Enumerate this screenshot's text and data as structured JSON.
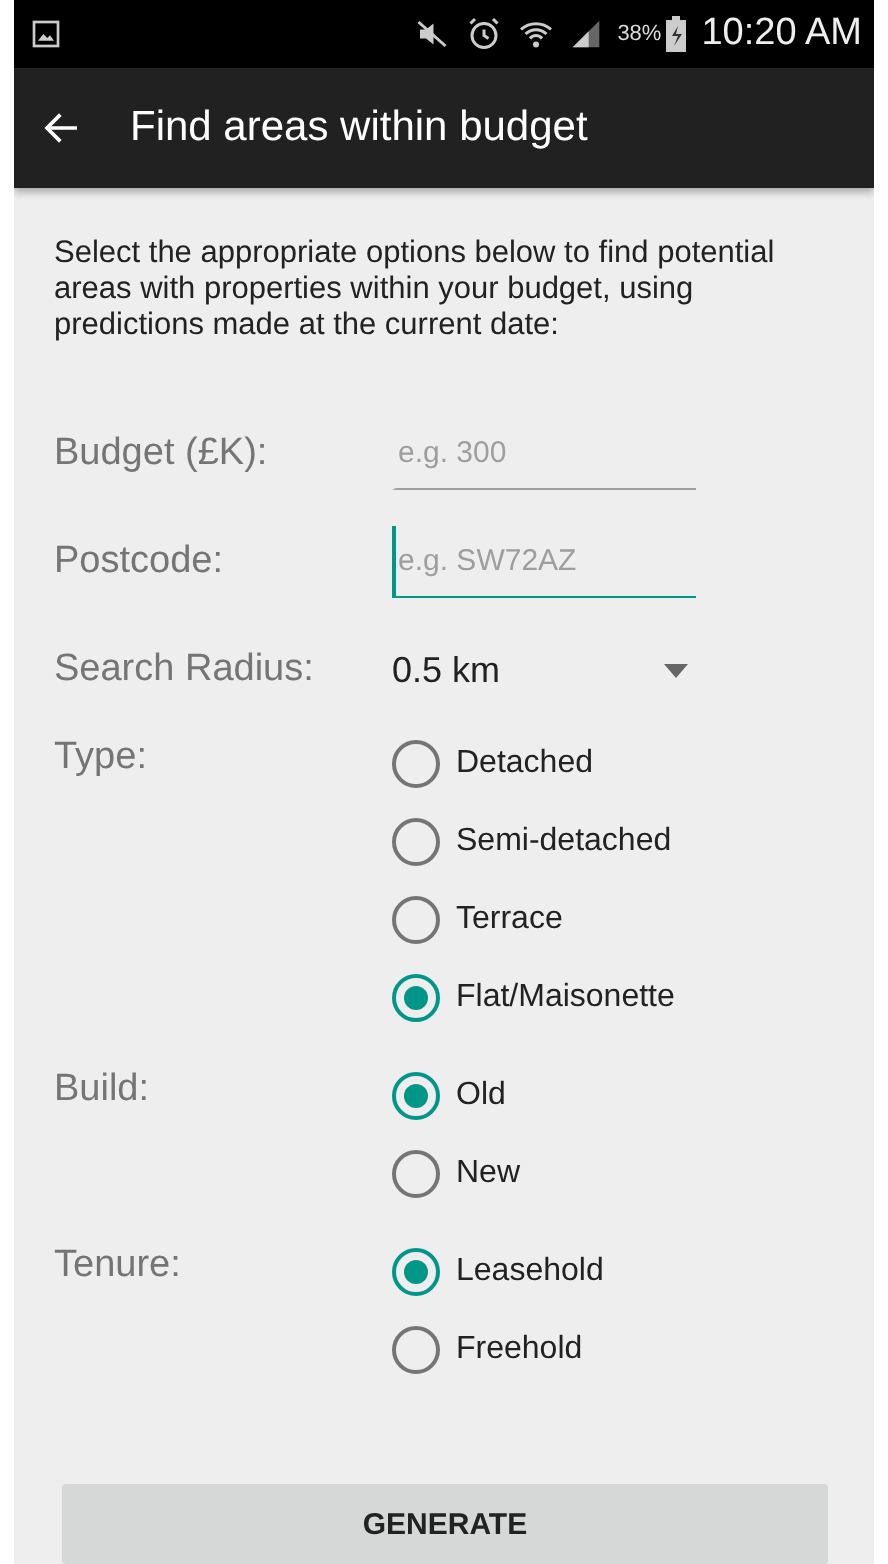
{
  "status_bar": {
    "battery": "38%",
    "time": "10:20 AM"
  },
  "app_bar": {
    "title": "Find areas within budget"
  },
  "intro": "Select the appropriate options below to find potential areas with properties within your budget, using predictions made at the current date:",
  "fields": [
    {
      "label": "Budget (£K):",
      "placeholder": "e.g. 300",
      "focused": false
    },
    {
      "label": "Postcode:",
      "placeholder": "e.g. SW72AZ",
      "focused": true
    }
  ],
  "search_radius": {
    "label": "Search Radius:",
    "value": "0.5 km"
  },
  "groups": [
    {
      "label": "Type:",
      "options": [
        {
          "label": "Detached",
          "selected": false
        },
        {
          "label": "Semi-detached",
          "selected": false
        },
        {
          "label": "Terrace",
          "selected": false
        },
        {
          "label": "Flat/Maisonette",
          "selected": true
        }
      ]
    },
    {
      "label": "Build:",
      "options": [
        {
          "label": "Old",
          "selected": true
        },
        {
          "label": "New",
          "selected": false
        }
      ]
    },
    {
      "label": "Tenure:",
      "options": [
        {
          "label": "Leasehold",
          "selected": true
        },
        {
          "label": "Freehold",
          "selected": false
        }
      ]
    }
  ],
  "button": "GENERATE"
}
